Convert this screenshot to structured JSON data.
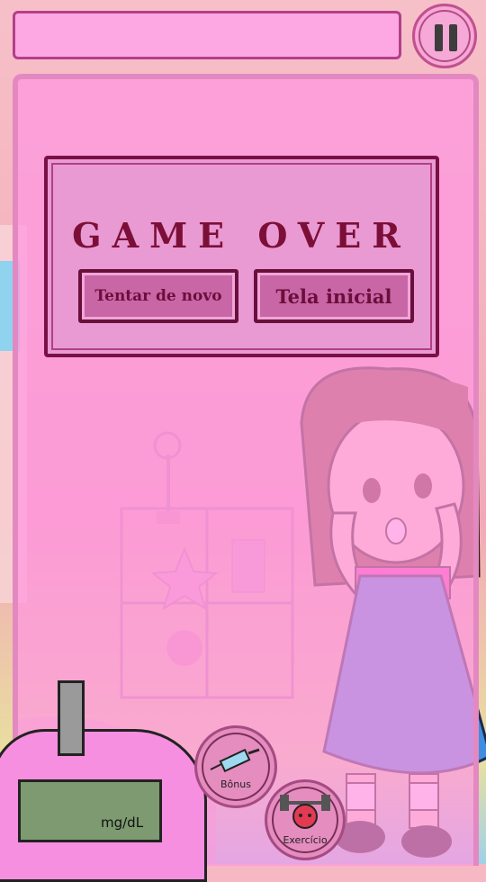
{
  "dialog": {
    "title": "GAME OVER",
    "retry_label": "Tentar de novo",
    "home_label": "Tela inicial"
  },
  "device": {
    "unit": "mg/dL"
  },
  "badges": {
    "bonus_label": "Bônus",
    "exercise_label": "Exercício"
  },
  "icons": {
    "pause": "pause-icon",
    "syringe": "syringe-icon",
    "dumbbell": "dumbbell-icon"
  },
  "colors": {
    "panel": "#fda8e3",
    "title": "#7c0f38",
    "button": "#c866a6"
  }
}
